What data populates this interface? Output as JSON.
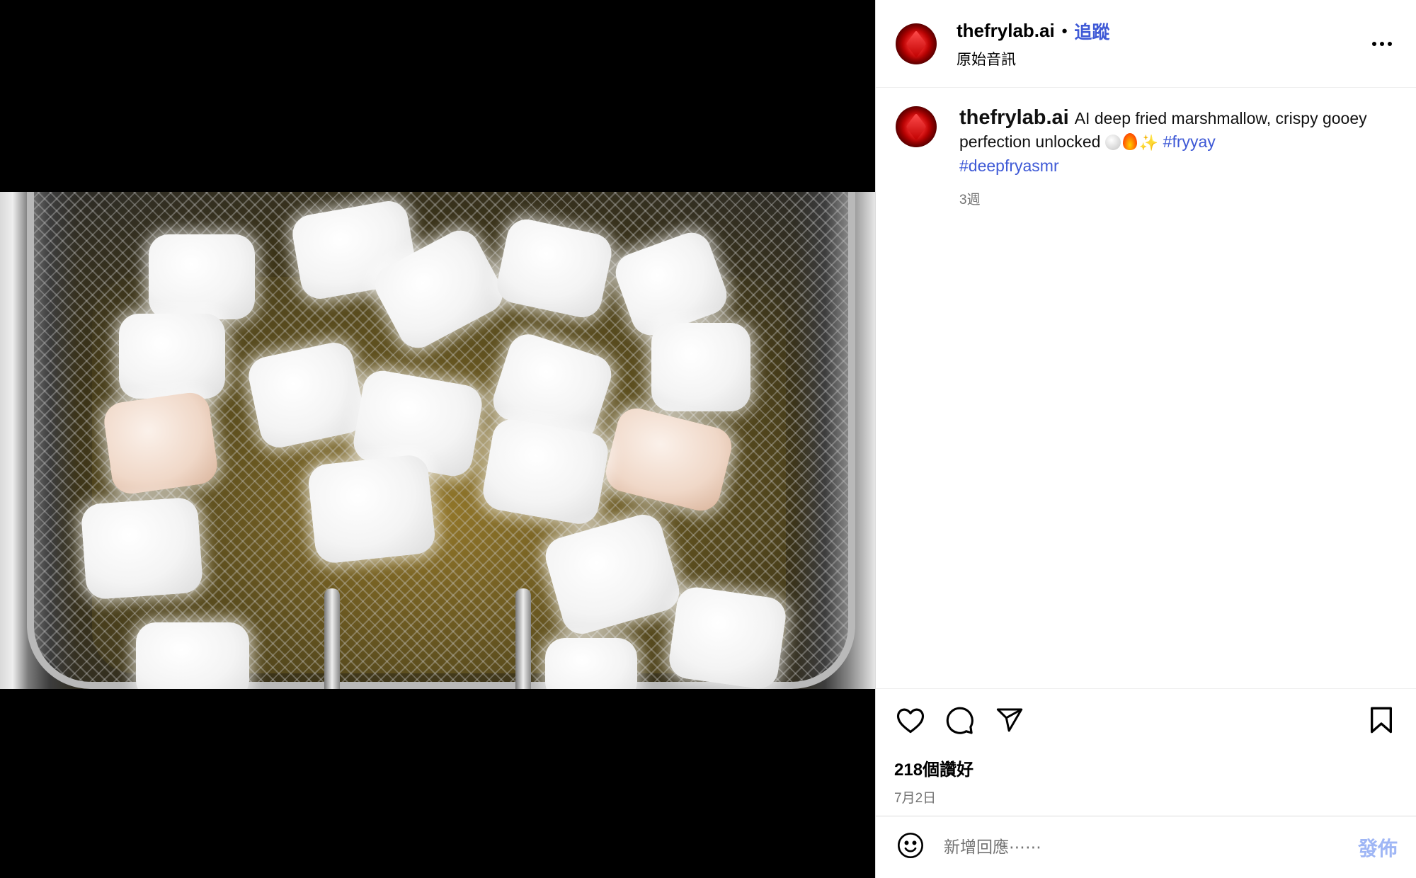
{
  "post": {
    "author": "thefrylab.ai",
    "separator": "•",
    "follow_label": "追蹤",
    "audio_label": "原始音訊",
    "more_icon": "more-horizontal-icon"
  },
  "caption": {
    "author": "thefrylab.ai",
    "text": "AI deep fried marshmallow, crispy gooey perfection unlocked",
    "hashtags": [
      "#fryyay",
      "#deepfryasmr"
    ],
    "emoji_sparkle": "✨",
    "age": "3週"
  },
  "media": {
    "mute_icon": "speaker-muted-icon"
  },
  "actions": {
    "like_icon": "heart-icon",
    "comment_icon": "comment-bubble-icon",
    "share_icon": "paper-plane-icon",
    "save_icon": "bookmark-icon",
    "likes_text": "218個讚好",
    "date": "7月2日"
  },
  "comment_box": {
    "placeholder": "新增回應⋯⋯",
    "post_label": "發佈",
    "emoji_icon": "smiley-face-icon"
  },
  "colors": {
    "link_blue": "#3e59d6",
    "post_disabled": "#9fb6f5",
    "secondary_text": "#737373",
    "avatar_red": "#d40000"
  }
}
